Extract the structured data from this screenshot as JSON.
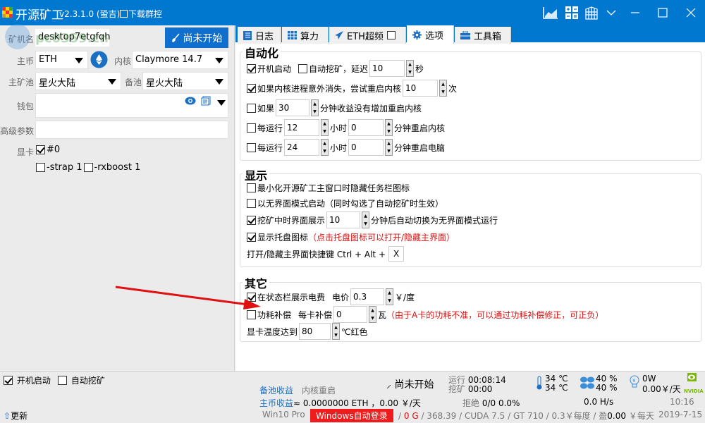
{
  "window": {
    "title": "开源矿工",
    "version": "v2.3.1.0 (蛩吉)",
    "group_control_link": "下载群控",
    "controls": [
      "chart-icon",
      "calc-icon",
      "building-icon",
      "chevron-down-icon",
      "minimize-icon",
      "maximize-icon",
      "close-icon"
    ]
  },
  "left": {
    "miner_name_label": "矿机名",
    "miner_name": "desktop7etgfqh",
    "start_button": "尚未开始",
    "coin_label": "主币",
    "coin": "ETH",
    "kernel_label": "内核",
    "kernel": "Claymore 14.7",
    "pool_label": "主矿池",
    "pool": "星火大陆",
    "backup_pool_label": "备池",
    "backup_pool": "星火大陆",
    "wallet_label": "钱包",
    "wallet": "",
    "adv_label": "高级参数",
    "adv": "",
    "gpu_label": "显卡",
    "gpu_item": "#0",
    "gpu_checked": true,
    "strap_label": "-strap 1",
    "rxboost_label": "-rxboost 1"
  },
  "tabs": [
    {
      "label": "日志",
      "icon": "log-icon"
    },
    {
      "label": "算力",
      "icon": "grid-icon"
    },
    {
      "label": "ETH超频",
      "icon": "send-icon"
    },
    {
      "label": "选项",
      "icon": "gear-icon",
      "active": true
    },
    {
      "label": "工具箱",
      "icon": "toolbox-icon"
    }
  ],
  "automation": {
    "title": "自动化",
    "autostart_label": "开机启动",
    "autostart": true,
    "automine_label": "自动挖矿，延迟",
    "automine": false,
    "automine_delay": "10",
    "seconds_unit": "秒",
    "restart_kernel_label": "如果内核进程意外消失，尝试重启内核",
    "restart_kernel": true,
    "restart_kernel_times": "10",
    "times_unit": "次",
    "if_label": "如果",
    "no_income_min": "30",
    "no_income_suffix": "分钟收益没有增加重启内核",
    "no_income": false,
    "every_run_label": "每运行",
    "hour_unit": "小时",
    "restart_kernel_every_hours": "12",
    "restart_kernel_every_mins": "0",
    "restart_kernel_suffix": "分钟重启内核",
    "restart_kernel_every": false,
    "restart_pc_every_hours": "24",
    "restart_pc_every_mins": "0",
    "restart_pc_suffix": "分钟重启电脑",
    "restart_pc_every": false
  },
  "display": {
    "title": "显示",
    "hide_taskbar_label": "最小化开源矿工主窗口时隐藏任务栏图标",
    "hide_taskbar": false,
    "headless_label": "以无界面模式启动（同时勾选了自动挖矿时生效）",
    "headless": false,
    "show_ui_label": "挖矿中时界面展示",
    "show_ui": true,
    "show_ui_minutes": "10",
    "show_ui_suffix": "分钟后自动切换为无界面模式运行",
    "tray_label": "显示托盘图标",
    "tray": true,
    "tray_hint": "（点击托盘图标可以打开/隐藏主界面）",
    "hotkey_label": "打开/隐藏主界面快捷键 Ctrl + Alt +",
    "hotkey_key": "X"
  },
  "other": {
    "title": "其它",
    "power_cost_label": "在状态栏展示电费",
    "power_cost": true,
    "price_label": "电价",
    "price": "0.3",
    "price_unit": "￥/度",
    "power_comp_label": "功耗补偿",
    "power_comp": false,
    "per_card_label": "每卡补偿",
    "per_card": "0",
    "watt_unit": "瓦",
    "power_comp_hint": "（由于A卡的功耗不准，可以通过功耗补偿修正，可正负）",
    "temp_label": "显卡温度达到",
    "temp": "80",
    "temp_suffix": "℃红色"
  },
  "status": {
    "autostart_label": "开机启动",
    "autostart": true,
    "automine_label": "自动挖矿",
    "automine": false,
    "update_label": "更新",
    "backup_income_label": "备池收益",
    "kernel_restart_label": "内核重启",
    "main_income_label": "主币收益",
    "main_income_value": "≈ 0.0000000 ETH ，0.00 ￥/天",
    "mining_state": "尚未开始",
    "run_label": "运行",
    "run_time": "00:08:14",
    "mine_label": "挖矿",
    "mine_time": "00:00",
    "reject_label": "拒绝",
    "reject_value": "0/0  0.0%",
    "temp1": "34 ℃",
    "temp2": "34 ℃",
    "fan1": "40 %",
    "fan2": "40 %",
    "hashrate": "0.0 H/s",
    "power": "0W",
    "cost": "0.00￥/天",
    "time": "10:16",
    "os": "Win10 Pro",
    "win_autologin": "Windows自动登录",
    "gpu_mem_prefix": "/",
    "gpu_mem": "0 G",
    "sysinfo": "/ 368.39 / CUDA 7.5 / GT 710 / 0.3￥每度 / 盈",
    "profit": "0.00",
    "profit_suffix": "￥每天",
    "date": "2019-7-15",
    "vendor": "NVIDIA"
  }
}
